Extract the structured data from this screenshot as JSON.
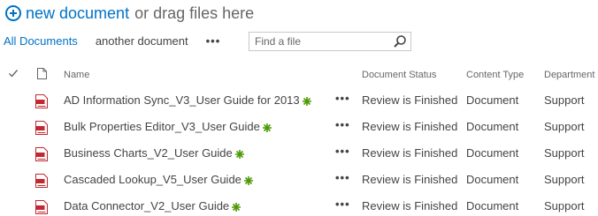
{
  "toolbar": {
    "new_document_label": "new document",
    "drag_text": "or drag files here"
  },
  "views": {
    "current": "All Documents",
    "other": "another document",
    "more": "•••"
  },
  "search": {
    "placeholder": "Find a file"
  },
  "columns": {
    "name": "Name",
    "status": "Document Status",
    "content_type": "Content Type",
    "department": "Department"
  },
  "rows": [
    {
      "name": "AD Information Sync_V3_User Guide for 2013",
      "status": "Review is Finished",
      "content_type": "Document",
      "department": "Support",
      "menu": "•••"
    },
    {
      "name": "Bulk Properties Editor_V3_User Guide",
      "status": "Review is Finished",
      "content_type": "Document",
      "department": "Support",
      "menu": "•••"
    },
    {
      "name": "Business Charts_V2_User Guide",
      "status": "Review is Finished",
      "content_type": "Document",
      "department": "Support",
      "menu": "•••"
    },
    {
      "name": "Cascaded Lookup_V5_User Guide",
      "status": "Review is Finished",
      "content_type": "Document",
      "department": "Support",
      "menu": "•••"
    },
    {
      "name": "Data Connector_V2_User Guide",
      "status": "Review is Finished",
      "content_type": "Document",
      "department": "Support",
      "menu": "•••"
    }
  ],
  "colors": {
    "accent": "#0072c6",
    "pdf_red": "#c4282e",
    "new_green": "#4e9a06",
    "text": "#444444"
  },
  "icons": {
    "new": "plus-circle-icon",
    "search": "magnifier-icon",
    "check_all": "checkmark-icon",
    "file_type": "document-icon",
    "row_file": "pdf-icon",
    "row_new": "new-sparkle-icon"
  }
}
